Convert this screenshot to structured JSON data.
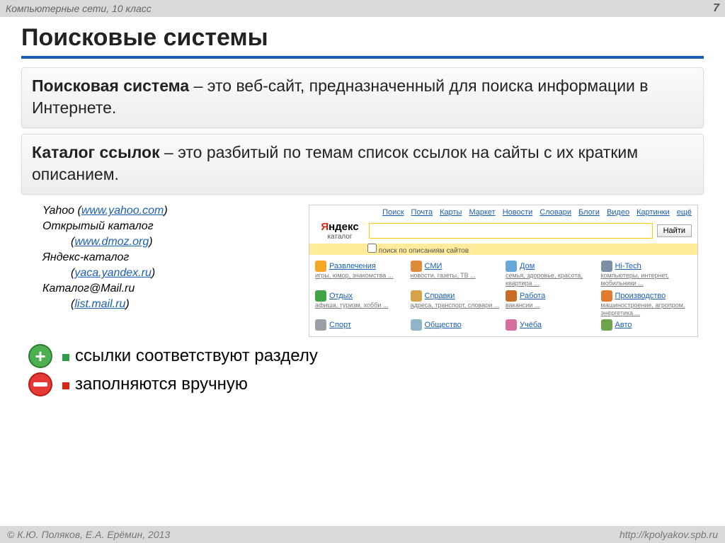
{
  "header": {
    "subject": "Компьютерные сети, 10 класс",
    "page": "7"
  },
  "title": "Поисковые системы",
  "def1": {
    "term": "Поисковая система",
    "text": " – это веб-сайт, предназначенный для поиска информации в Интернете."
  },
  "def2": {
    "term": "Каталог ссылок",
    "text": " – это разбитый по темам список ссылок на сайты с их кратким описанием."
  },
  "catalogs": [
    {
      "name": "Yahoo",
      "url": "www.yahoo.com"
    },
    {
      "name": "Открытый каталог",
      "url": "www.dmoz.org"
    },
    {
      "name": "Яндекс-каталог",
      "url": "yaca.yandex.ru"
    },
    {
      "name": "Каталог@Mail.ru",
      "url": "list.mail.ru"
    }
  ],
  "yandex": {
    "logo_red": "Я",
    "logo_rest": "ндекс",
    "logo_sub": "каталог",
    "top_links": [
      "Поиск",
      "Почта",
      "Карты",
      "Маркет",
      "Новости",
      "Словари",
      "Блоги",
      "Видео",
      "Картинки",
      "ещё"
    ],
    "search_btn": "Найти",
    "chk_label": "поиск по описаниям сайтов",
    "cats": [
      {
        "t": "Развлечения",
        "d": "игры, юмор, знакомства ...",
        "c": "#f5a623"
      },
      {
        "t": "СМИ",
        "d": "новости, газеты, ТВ ...",
        "c": "#e08b3b"
      },
      {
        "t": "Дом",
        "d": "семья, здоровье, красота, квартира ...",
        "c": "#6aa8d8"
      },
      {
        "t": "Hi-Tech",
        "d": "компьютеры, интернет, мобильники ...",
        "c": "#7b8fa6"
      },
      {
        "t": "Отдых",
        "d": "афиша, туризм, хобби ...",
        "c": "#3fa545"
      },
      {
        "t": "Справки",
        "d": "адреса, транспорт, словари ...",
        "c": "#d6a24a"
      },
      {
        "t": "Работа",
        "d": "вакансии ...",
        "c": "#c86d28"
      },
      {
        "t": "Производство",
        "d": "машиностроение, агропром, энергетика ...",
        "c": "#e07b2e"
      },
      {
        "t": "Спорт",
        "d": "",
        "c": "#9aa0a6"
      },
      {
        "t": "Общество",
        "d": "",
        "c": "#8fb5c7"
      },
      {
        "t": "Учёба",
        "d": "",
        "c": "#d46fa0"
      },
      {
        "t": "Авто",
        "d": "",
        "c": "#6da34a"
      }
    ]
  },
  "bullets": {
    "plus": "ссылки соответствуют разделу",
    "minus": "заполняются вручную"
  },
  "footer": {
    "left": "© К.Ю. Поляков, Е.А. Ерёмин, 2013",
    "right": "http://kpolyakov.spb.ru"
  }
}
